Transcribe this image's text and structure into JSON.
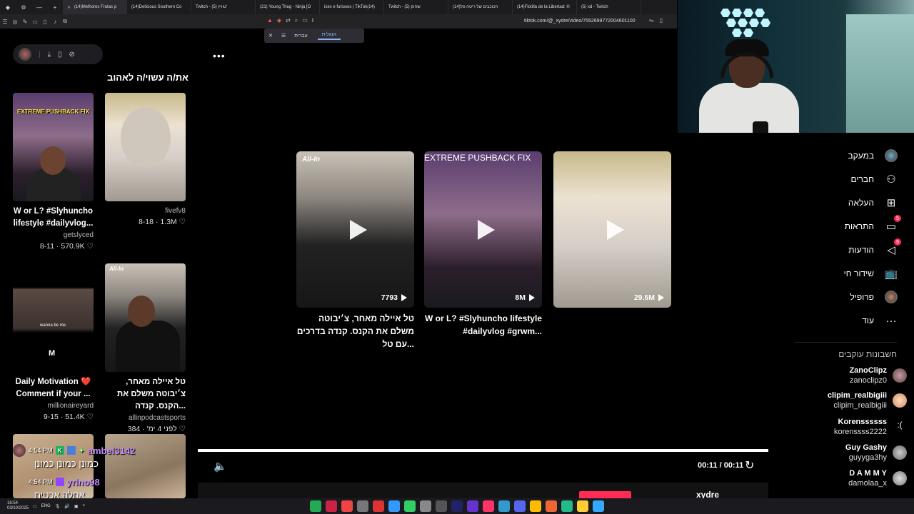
{
  "browser": {
    "tabs": [
      {
        "label": "(14)Melhores Frutas p",
        "active": true
      },
      {
        "label": "(14)Delicious Southern Co",
        "active": false
      },
      {
        "label": "Twitch - (5) טוויץ'",
        "active": false
      },
      {
        "label": "(21) Young Thug - Ninja [O",
        "active": false
      },
      {
        "label": "ices e furiosos | TikTok(14)",
        "active": false
      },
      {
        "label": "Twitch - (5) שחוק",
        "active": false
      },
      {
        "label": "(14)הכוכבים של ריטה פל",
        "active": false
      },
      {
        "label": "(14)Flotilla de la Libertad: H",
        "active": false
      },
      {
        "label": "(5) xd - Twitch",
        "active": false
      }
    ],
    "url": "tiktok.com/@_xydre/video/7552699772004601100",
    "translate_popup": {
      "option_1": "אנגלית",
      "option_2": "עברית",
      "selected": "אנגלית"
    }
  },
  "recommend": {
    "title": "את/ה עשוי/ה לאהוב",
    "cards": [
      {
        "banner": "EXTREME PUSHBACK FIX",
        "title": "W or L? #Slyhuncho lifestyle #dailyvlog...",
        "author": "getslyced",
        "meta": "8-11 · 570.9K ♡"
      },
      {
        "title": "",
        "author": "fivefv8",
        "meta": "8-18 · 1.3M ♡"
      },
      {
        "caption": "wanna be me",
        "title": "Daily Motivation ❤️ Comment if your ...",
        "author": "millionaireyard",
        "meta": "9-15 · 51.4K ♡"
      },
      {
        "banner": "All-In",
        "title": "טל איילה מאחר, צ׳יבוטה משלם את הקנס. קנדה...",
        "author": "allinpodcastsports",
        "meta": "לפני 4 ימ' · 384 ♡"
      }
    ]
  },
  "videos": [
    {
      "banner": "All-In",
      "views": "7793",
      "title": "טל איילה מאחר, צ׳יבוטה משלם את הקנס. קנדה בדרכים עם טל..."
    },
    {
      "banner": "EXTREME PUSHBACK FIX",
      "views": "8M",
      "title": "W or L? #Slyhuncho lifestyle #dailyvlog #grwm..."
    },
    {
      "views": "29.5M",
      "title": ""
    }
  ],
  "player": {
    "time": "00:11 / 00:11",
    "progress": 1.0,
    "author_peek": "xydre"
  },
  "sidebar": {
    "nav": [
      {
        "label": "במעקב",
        "icon": "avatar-icon"
      },
      {
        "label": "חברים",
        "icon": "friends-icon"
      },
      {
        "label": "העלאה",
        "icon": "upload-icon"
      },
      {
        "label": "התראות",
        "icon": "notifications-icon",
        "badge": "5"
      },
      {
        "label": "הודעות",
        "icon": "messages-icon",
        "badge": "9"
      },
      {
        "label": "שידור חי",
        "icon": "live-icon"
      },
      {
        "label": "פרופיל",
        "icon": "profile-icon"
      },
      {
        "label": "עוד",
        "icon": "more-icon"
      }
    ],
    "following_title": "חשבונות עוקבים",
    "accounts": [
      {
        "name": "ZanoClipz",
        "handle": "zanoclipz0"
      },
      {
        "name": "clipim_realbigiii",
        "handle": "clipim_realbigiii"
      },
      {
        "name": "Korenssssss",
        "handle": "korenssss2222"
      },
      {
        "name": "Guy Gashy",
        "handle": "guyyga3hy"
      },
      {
        "name": "D A M M Y",
        "handle": "damolaa_x"
      }
    ]
  },
  "chat": {
    "lines": [
      {
        "time": "4:54 PM",
        "user": "ambel3142",
        "message": "כמונן כמונן כמונן"
      },
      {
        "time": "4:54 PM",
        "user": "yrino98",
        "message": "אחלה אכטית"
      }
    ]
  },
  "taskbar": {
    "time": "16:54",
    "date": "03/10/2025",
    "lang": "ENG"
  },
  "colors": {
    "accent": "#fe2c55",
    "background": "#000000",
    "chat_name": "#c28bff"
  }
}
